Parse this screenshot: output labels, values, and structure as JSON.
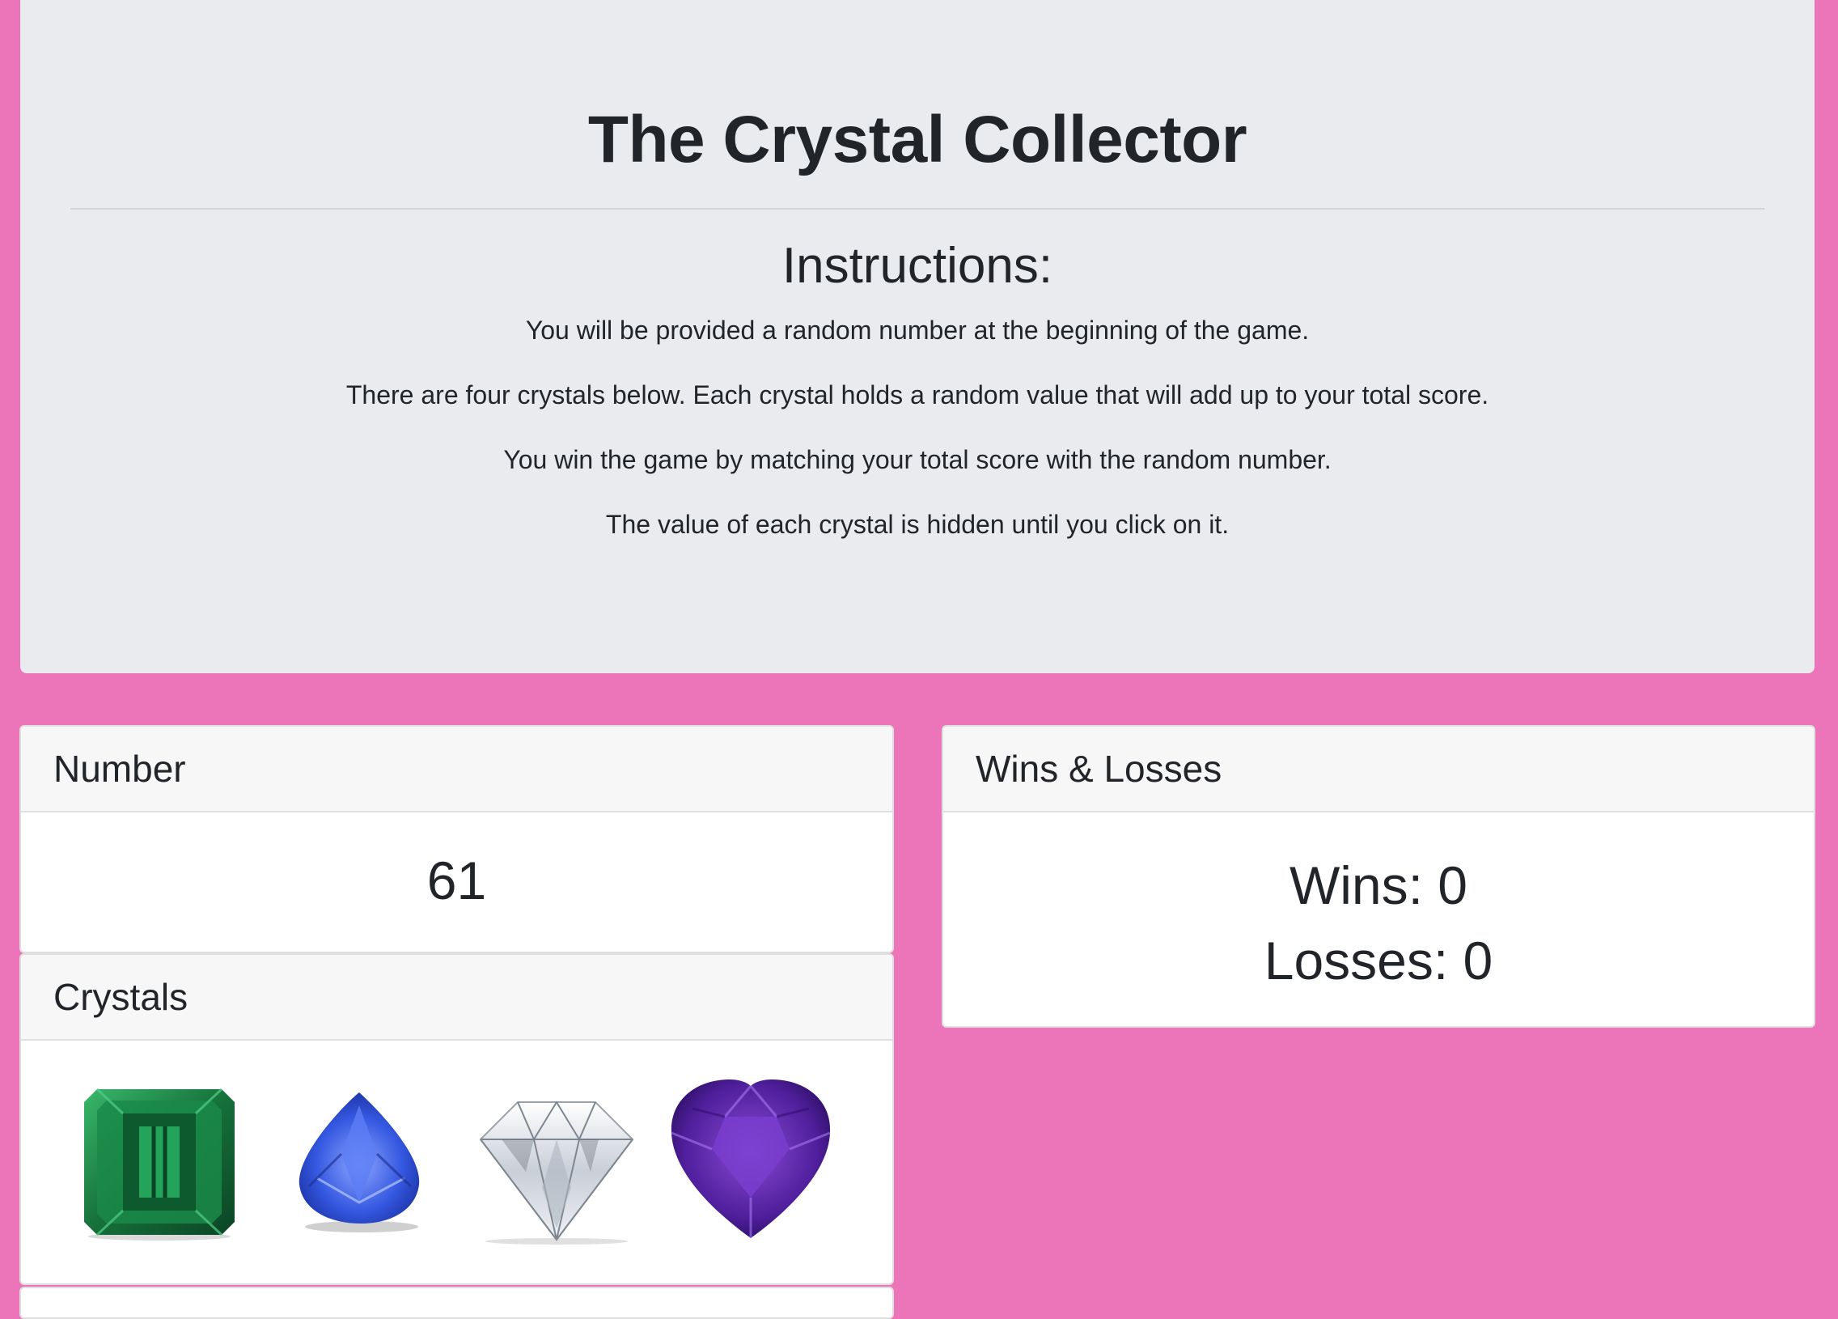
{
  "header": {
    "title": "The Crystal Collector",
    "instructions_heading": "Instructions:",
    "instructions": [
      "You will be provided a random number at the beginning of the game.",
      "There are four crystals below. Each crystal holds a random value that will add up to your total score.",
      "You win the game by matching your total score with the random number.",
      "The value of each crystal is hidden until you click on it."
    ]
  },
  "number_card": {
    "title": "Number",
    "value": "61"
  },
  "crystals_card": {
    "title": "Crystals",
    "crystals": [
      {
        "name": "green-emerald-crystal",
        "color": "#1f7a3f"
      },
      {
        "name": "blue-sapphire-crystal",
        "color": "#2b4bd1"
      },
      {
        "name": "clear-diamond-crystal",
        "color": "#d8dde3"
      },
      {
        "name": "purple-amethyst-crystal",
        "color": "#4b1d8f"
      }
    ]
  },
  "stats_card": {
    "title": "Wins & Losses",
    "wins": "Wins: 0",
    "losses": "Losses: 0"
  },
  "colors": {
    "page_background": "#ec75b9",
    "jumbotron_background": "#eaebef",
    "card_header_background": "#f7f7f7"
  }
}
